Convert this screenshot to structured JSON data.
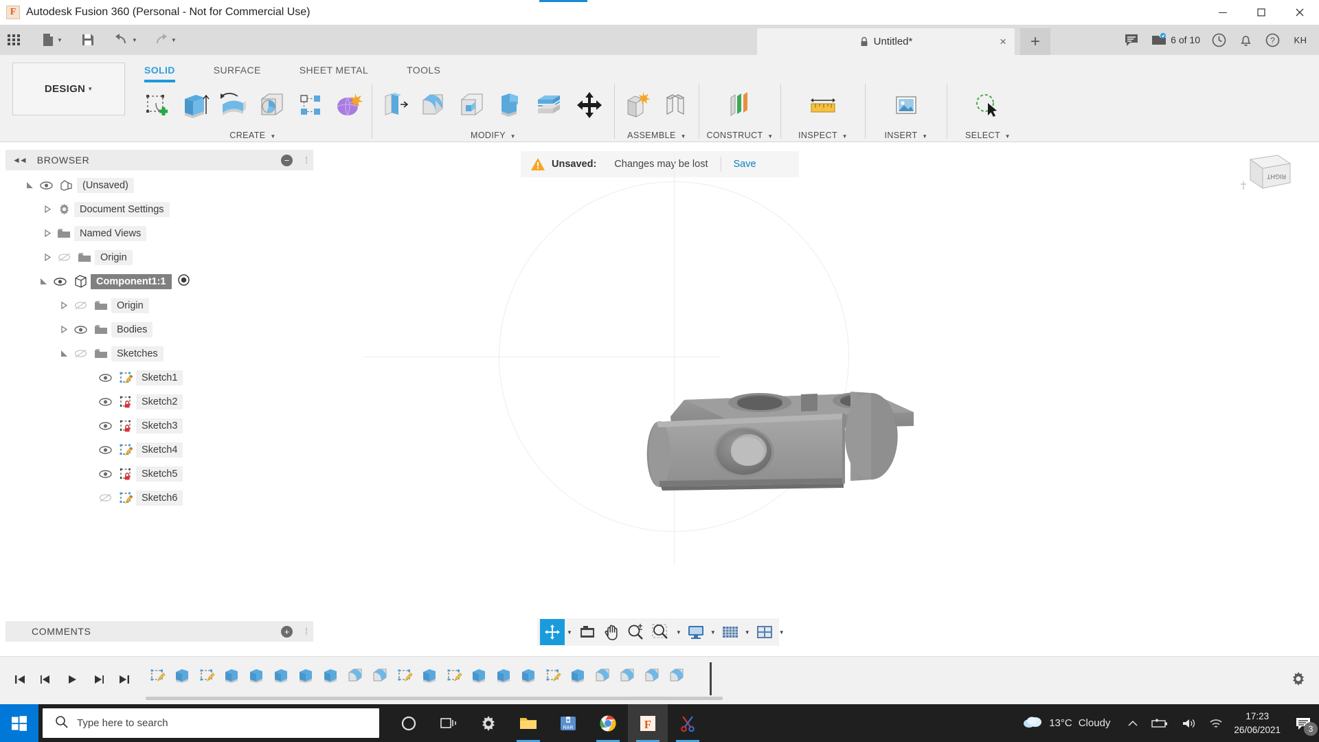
{
  "window": {
    "title": "Autodesk Fusion 360 (Personal - Not for Commercial Use)",
    "app_icon": "fusion-360-icon",
    "minimize": "minimize-icon",
    "maximize": "maximize-icon",
    "close": "close-icon"
  },
  "quickbar": {
    "grid": "app-grid-icon",
    "new": "new-document-icon",
    "save": "save-icon",
    "undo": "undo-icon",
    "redo": "redo-icon",
    "tab_title": "Untitled*",
    "tab_close": "×",
    "tab_add": "+",
    "comment_icon": "comment-icon",
    "jobs_icon": "jobs-icon",
    "jobs_text": "6 of 10",
    "history_icon": "clock-icon",
    "notification_icon": "bell-icon",
    "help_icon": "help-icon",
    "user_initials": "KH"
  },
  "ribbon": {
    "workspace": "DESIGN",
    "tabs": [
      {
        "label": "SOLID",
        "active": true
      },
      {
        "label": "SURFACE",
        "active": false
      },
      {
        "label": "SHEET METAL",
        "active": false
      },
      {
        "label": "TOOLS",
        "active": false
      }
    ],
    "groups": [
      {
        "label": "CREATE",
        "tools": [
          "create-sketch-icon",
          "extrude-icon",
          "revolve-icon",
          "sweep-icon",
          "pattern-icon",
          "form-icon"
        ]
      },
      {
        "label": "MODIFY",
        "tools": [
          "press-pull-icon",
          "fillet-icon",
          "shell-icon",
          "combine-icon",
          "offset-face-icon",
          "move-copy-icon"
        ]
      },
      {
        "label": "ASSEMBLE",
        "tools": [
          "new-component-icon",
          "joint-icon"
        ]
      },
      {
        "label": "CONSTRUCT",
        "tools": [
          "offset-plane-icon"
        ]
      },
      {
        "label": "INSPECT",
        "tools": [
          "measure-icon"
        ]
      },
      {
        "label": "INSERT",
        "tools": [
          "insert-image-icon"
        ]
      },
      {
        "label": "SELECT",
        "tools": [
          "select-icon"
        ]
      }
    ]
  },
  "browser": {
    "title": "BROWSER",
    "collapse_icon": "collapse-left-icon",
    "minus_icon": "collapse-panel-icon",
    "nodes": [
      {
        "label": "(Unsaved)",
        "indent": 0,
        "arrow": "expanded",
        "eye": "visible",
        "icon": "document-icon",
        "selected": false
      },
      {
        "label": "Document Settings",
        "indent": 1,
        "arrow": "collapsed",
        "eye": "none",
        "icon": "gear-icon",
        "selected": false
      },
      {
        "label": "Named Views",
        "indent": 1,
        "arrow": "collapsed",
        "eye": "none",
        "icon": "folder-icon",
        "selected": false
      },
      {
        "label": "Origin",
        "indent": 1,
        "arrow": "collapsed",
        "eye": "hidden",
        "icon": "folder-icon",
        "selected": false
      },
      {
        "label": "Component1:1",
        "indent": 0,
        "arrow": "expanded",
        "eye": "visible",
        "icon": "component-icon",
        "selected": true,
        "radio": "activate-radio-icon"
      },
      {
        "label": "Origin",
        "indent": 2,
        "arrow": "collapsed",
        "eye": "hidden",
        "icon": "folder-icon",
        "selected": false
      },
      {
        "label": "Bodies",
        "indent": 2,
        "arrow": "collapsed",
        "eye": "visible",
        "icon": "folder-icon",
        "selected": false
      },
      {
        "label": "Sketches",
        "indent": 2,
        "arrow": "expanded",
        "eye": "hidden",
        "icon": "folder-icon",
        "selected": false
      },
      {
        "label": "Sketch1",
        "indent": 4,
        "arrow": "none",
        "eye": "visible",
        "icon": "sketch-unlocked-icon",
        "selected": false
      },
      {
        "label": "Sketch2",
        "indent": 4,
        "arrow": "none",
        "eye": "visible",
        "icon": "sketch-locked-icon",
        "selected": false
      },
      {
        "label": "Sketch3",
        "indent": 4,
        "arrow": "none",
        "eye": "visible",
        "icon": "sketch-locked-icon",
        "selected": false
      },
      {
        "label": "Sketch4",
        "indent": 4,
        "arrow": "none",
        "eye": "visible",
        "icon": "sketch-unlocked-icon",
        "selected": false
      },
      {
        "label": "Sketch5",
        "indent": 4,
        "arrow": "none",
        "eye": "visible",
        "icon": "sketch-locked-icon",
        "selected": false
      },
      {
        "label": "Sketch6",
        "indent": 4,
        "arrow": "none",
        "eye": "hidden",
        "icon": "sketch-unlocked-icon",
        "selected": false
      }
    ]
  },
  "canvas": {
    "banner": {
      "warning_icon": "warning-triangle-icon",
      "label": "Unsaved:",
      "message": "Changes may be lost",
      "save_link": "Save"
    },
    "viewcube_face": "RIGHT",
    "model_name": "clamp-block-model"
  },
  "comments": {
    "title": "COMMENTS",
    "plus_icon": "add-comment-icon"
  },
  "navbar": {
    "buttons": [
      {
        "name": "orbit-button",
        "icon": "orbit-icon",
        "active": true,
        "has_caret": true
      },
      {
        "name": "viewcube-grid-button",
        "icon": "camera-icon",
        "active": false,
        "has_caret": false
      },
      {
        "name": "pan-button",
        "icon": "pan-hand-icon",
        "active": false,
        "has_caret": false
      },
      {
        "name": "zoom-button",
        "icon": "zoom-magnifier-icon",
        "active": false,
        "has_caret": false
      },
      {
        "name": "fit-button",
        "icon": "fit-window-icon",
        "active": false,
        "has_caret": true
      },
      {
        "name": "display-settings-button",
        "icon": "display-monitor-icon",
        "active": false,
        "has_caret": true
      },
      {
        "name": "grid-snaps-button",
        "icon": "grid-icon",
        "active": false,
        "has_caret": true
      },
      {
        "name": "viewports-button",
        "icon": "viewports-icon",
        "active": false,
        "has_caret": true
      }
    ]
  },
  "timeline": {
    "playback": [
      "go-to-beginning-icon",
      "step-back-icon",
      "play-icon",
      "step-forward-icon",
      "go-to-end-icon"
    ],
    "feature_count": 22,
    "settings_icon": "gear-icon"
  },
  "taskbar": {
    "start_icon": "windows-start-icon",
    "search_icon": "search-icon",
    "search_placeholder": "Type here to search",
    "apps": [
      {
        "name": "cortana-icon",
        "running": false,
        "active": false
      },
      {
        "name": "task-view-icon",
        "running": false,
        "active": false
      },
      {
        "name": "settings-gear-icon",
        "running": false,
        "active": false
      },
      {
        "name": "file-explorer-icon",
        "running": true,
        "active": false
      },
      {
        "name": "winrar-icon",
        "running": false,
        "active": false
      },
      {
        "name": "chrome-icon",
        "running": true,
        "active": false
      },
      {
        "name": "fusion-360-icon",
        "running": true,
        "active": true
      },
      {
        "name": "snipping-tool-icon",
        "running": true,
        "active": false
      }
    ],
    "tray": {
      "weather_icon": "cloud-icon",
      "temperature": "13°C",
      "condition": "Cloudy",
      "chevron_icon": "show-hidden-icons-icon",
      "battery_icon": "battery-charging-icon",
      "volume_icon": "volume-icon",
      "network_icon": "wifi-icon",
      "time": "17:23",
      "date": "26/06/2021",
      "notification_icon": "action-center-icon",
      "notification_count": "3"
    }
  },
  "colors": {
    "accent_blue": "#1a9bdc",
    "tab_active": "#2b9fe0",
    "save_link": "#0a7ec4",
    "warning": "#f0a020",
    "start_blue": "#0078d7",
    "sketch_lock_red": "#e03030",
    "taskbar_bg": "#1f1f1f"
  }
}
